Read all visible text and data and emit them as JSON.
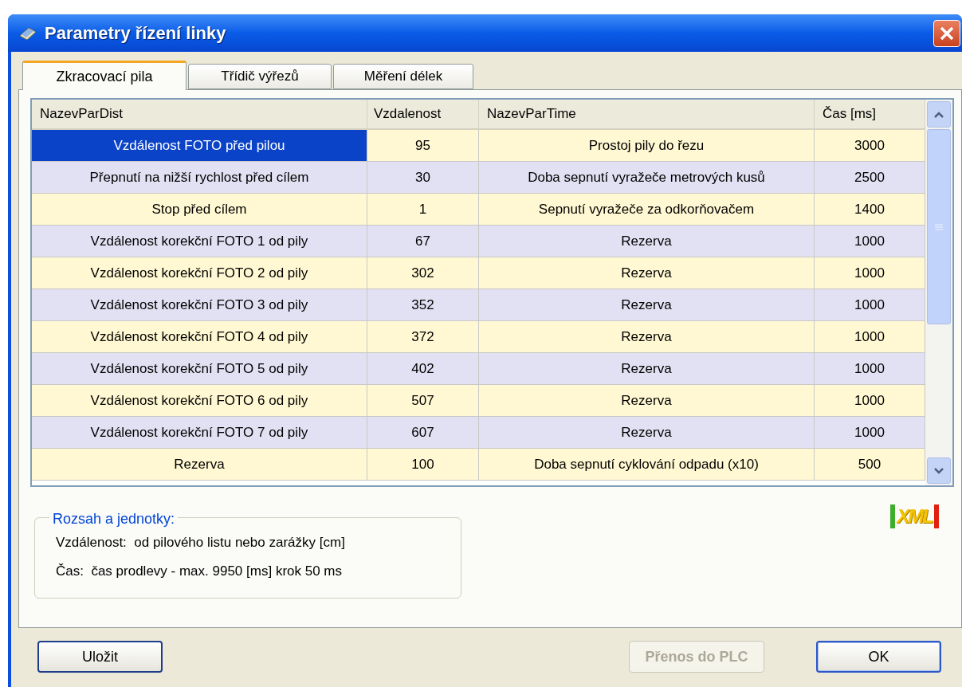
{
  "window": {
    "title": "Parametry řízení linky"
  },
  "tabs": [
    {
      "label": "Zkracovací pila",
      "selected": true
    },
    {
      "label": "Třídič výřezů",
      "selected": false
    },
    {
      "label": "Měření délek",
      "selected": false
    }
  ],
  "table": {
    "columns": [
      "NazevParDist",
      "Vzdalenost",
      "NazevParTime",
      "Čas [ms]"
    ],
    "rows": [
      {
        "cells": [
          "Vzdálenost FOTO před pilou",
          "95",
          "Prostoj pily do řezu",
          "3000"
        ],
        "selected": true
      },
      {
        "cells": [
          "Přepnutí na nižší rychlost před cílem",
          "30",
          "Doba sepnutí vyražeče metrových kusů",
          "2500"
        ],
        "selected": false
      },
      {
        "cells": [
          "Stop před cílem",
          "1",
          "Sepnutí vyražeče za odkorňovačem",
          "1400"
        ],
        "selected": false
      },
      {
        "cells": [
          "Vzdálenost korekční FOTO 1 od pily",
          "67",
          "Rezerva",
          "1000"
        ],
        "selected": false
      },
      {
        "cells": [
          "Vzdálenost korekční FOTO 2 od pily",
          "302",
          "Rezerva",
          "1000"
        ],
        "selected": false
      },
      {
        "cells": [
          "Vzdálenost korekční FOTO 3 od pily",
          "352",
          "Rezerva",
          "1000"
        ],
        "selected": false
      },
      {
        "cells": [
          "Vzdálenost korekční FOTO 4 od pily",
          "372",
          "Rezerva",
          "1000"
        ],
        "selected": false
      },
      {
        "cells": [
          "Vzdálenost korekční FOTO 5 od pily",
          "402",
          "Rezerva",
          "1000"
        ],
        "selected": false
      },
      {
        "cells": [
          "Vzdálenost korekční FOTO 6 od pily",
          "507",
          "Rezerva",
          "1000"
        ],
        "selected": false
      },
      {
        "cells": [
          "Vzdálenost korekční FOTO 7 od pily",
          "607",
          "Rezerva",
          "1000"
        ],
        "selected": false
      },
      {
        "cells": [
          "Rezerva",
          "100",
          "Doba sepnutí cyklování odpadu (x10)",
          "500"
        ],
        "selected": false
      }
    ]
  },
  "units_group": {
    "title": "Rozsah a jednotky:",
    "lines": [
      "Vzdálenost:  od pilového listu nebo zarážky [cm]",
      "Čas:  čas prodlevy - max. 9950 [ms] krok 50 ms"
    ]
  },
  "logo": "XML",
  "buttons": [
    {
      "label": "Uložit",
      "disabled": false,
      "default": false
    },
    {
      "label": "Přenos do PLC",
      "disabled": true,
      "default": false
    },
    {
      "label": "OK",
      "disabled": false,
      "default": true
    }
  ]
}
